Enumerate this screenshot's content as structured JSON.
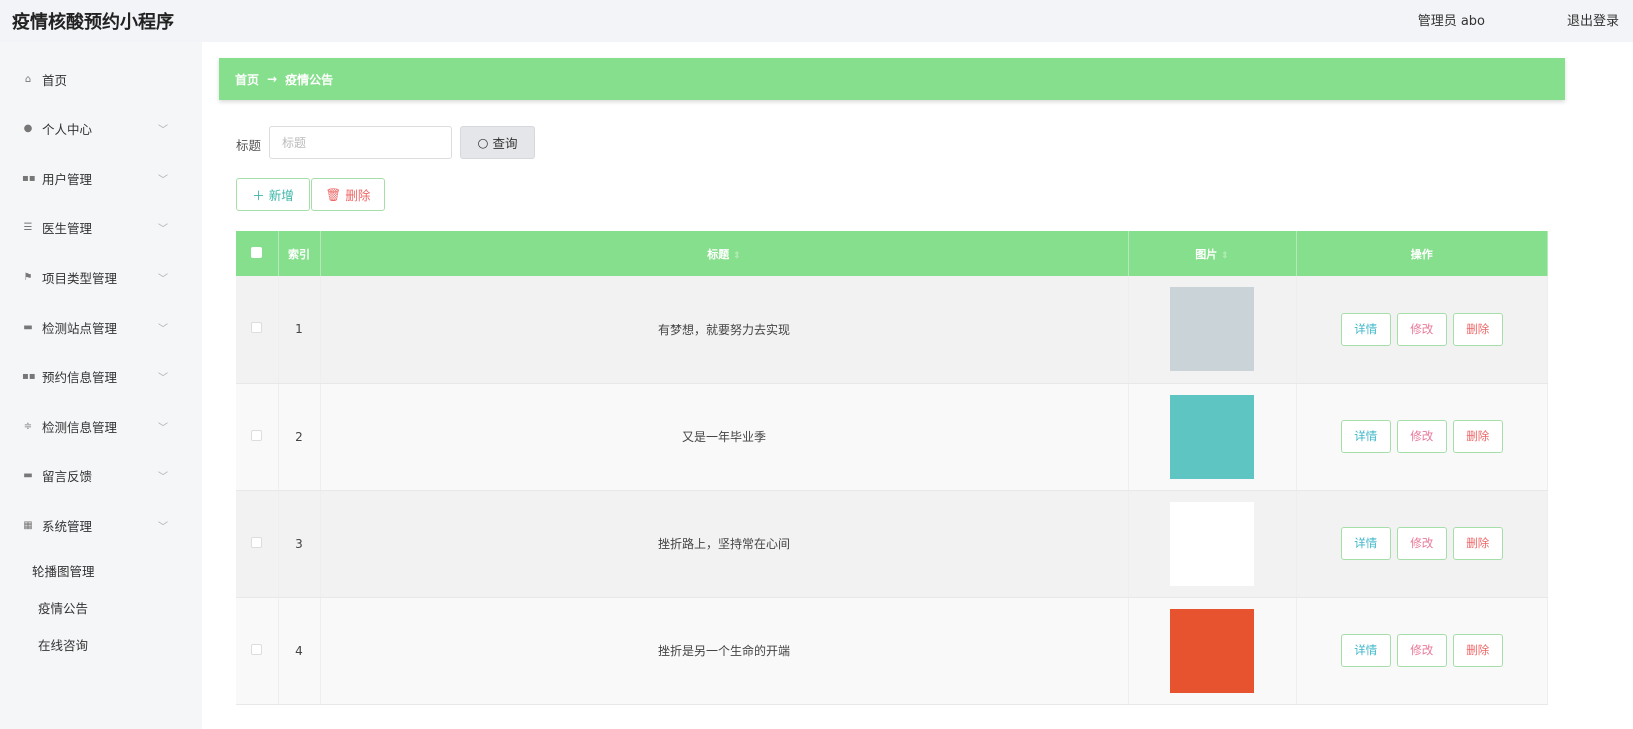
{
  "header": {
    "title": "疫情核酸预约小程序",
    "user": "管理员 abo",
    "logout": "退出登录"
  },
  "sidebar": {
    "items": [
      {
        "label": "首页",
        "icon": "home-icon",
        "glyph": "⌂",
        "chevron": false
      },
      {
        "label": "个人中心",
        "icon": "user-icon",
        "glyph": "●",
        "chevron": true
      },
      {
        "label": "用户管理",
        "icon": "grid-icon",
        "glyph": "▪▪",
        "chevron": true
      },
      {
        "label": "医生管理",
        "icon": "list-icon",
        "glyph": "☰",
        "chevron": true
      },
      {
        "label": "项目类型管理",
        "icon": "flag-icon",
        "glyph": "⚑",
        "chevron": true
      },
      {
        "label": "检测站点管理",
        "icon": "message-icon",
        "glyph": "▬",
        "chevron": true
      },
      {
        "label": "预约信息管理",
        "icon": "grid-icon",
        "glyph": "▪▪",
        "chevron": true
      },
      {
        "label": "检测信息管理",
        "icon": "sliders-icon",
        "glyph": "≑",
        "chevron": true
      },
      {
        "label": "留言反馈",
        "icon": "feedback-icon",
        "glyph": "▬",
        "chevron": true
      },
      {
        "label": "系统管理",
        "icon": "apps-icon",
        "glyph": "▦",
        "chevron": true
      }
    ],
    "sub_items": [
      "轮播图管理",
      "疫情公告",
      "在线咨询"
    ]
  },
  "breadcrumb": {
    "home": "首页",
    "arrow": "→",
    "current": "疫情公告"
  },
  "search": {
    "label": "标题",
    "placeholder": "标题",
    "value": "",
    "button": "查询"
  },
  "actions": {
    "add": "新增",
    "delete": "删除"
  },
  "table": {
    "headers": {
      "index": "索引",
      "title": "标题",
      "image": "图片",
      "actions": "操作"
    },
    "rows": [
      {
        "index": "1",
        "title": "有梦想，就要努力去实现",
        "image_color": "#c9d3d8"
      },
      {
        "index": "2",
        "title": "又是一年毕业季",
        "image_color": "#5ec5c2"
      },
      {
        "index": "3",
        "title": "挫折路上，坚持常在心间",
        "image_color": "#ffffff"
      },
      {
        "index": "4",
        "title": "挫折是另一个生命的开端",
        "image_color": "#e8532f"
      }
    ],
    "row_actions": {
      "detail": "详情",
      "edit": "修改",
      "delete": "删除"
    }
  },
  "colors": {
    "accent": "#86df8c"
  }
}
